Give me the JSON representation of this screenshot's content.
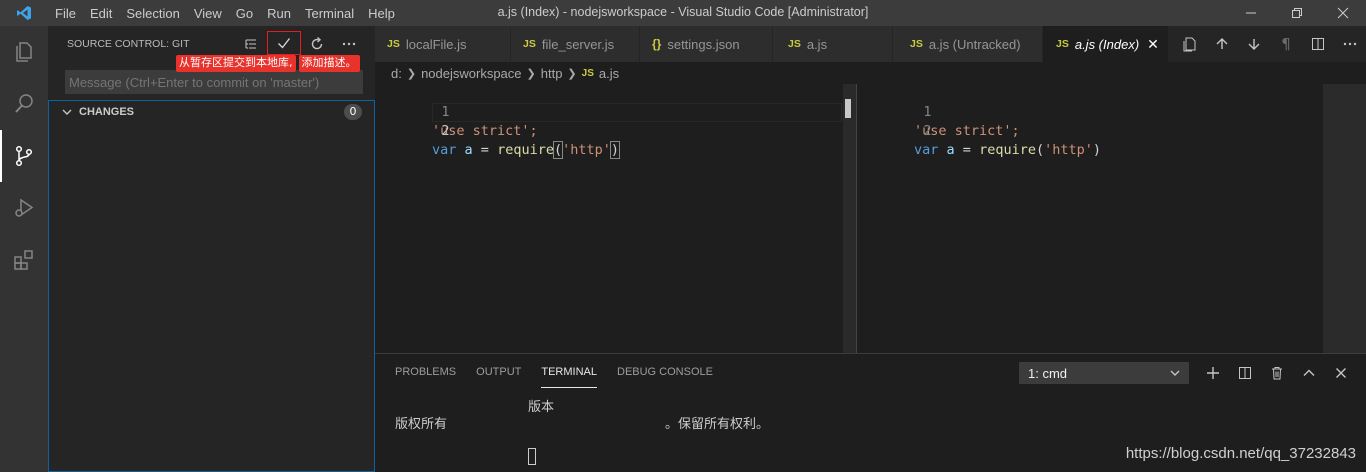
{
  "titlebar": {
    "menu": [
      "File",
      "Edit",
      "Selection",
      "View",
      "Go",
      "Run",
      "Terminal",
      "Help"
    ],
    "title": "a.js (Index) - nodejsworkspace - Visual Studio Code [Administrator]"
  },
  "activity_bar": {
    "icons": [
      "explorer-icon",
      "search-icon",
      "source-control-icon",
      "run-debug-icon",
      "extensions-icon"
    ],
    "active": "source-control-icon"
  },
  "sidebar": {
    "title": "SOURCE CONTROL: GIT",
    "actions": [
      "view-as-tree-icon",
      "commit-check-icon",
      "refresh-icon",
      "more-actions-icon"
    ],
    "annotation": [
      "从暂存区提交到本地库,",
      "添加描述。"
    ],
    "message_placeholder": "Message (Ctrl+Enter to commit on 'master')",
    "changes_label": "CHANGES",
    "changes_count": "0"
  },
  "tabs": [
    {
      "icon": "JS",
      "label": "localFile.js",
      "active": false
    },
    {
      "icon": "JS",
      "label": "file_server.js",
      "active": false
    },
    {
      "icon": "{}",
      "label": "settings.json",
      "active": false
    },
    {
      "icon": "JS",
      "label": "a.js",
      "active": false
    },
    {
      "icon": "JS",
      "label": "a.js (Untracked)",
      "active": false
    },
    {
      "icon": "JS",
      "label": "a.js (Index)",
      "active": true
    }
  ],
  "breadcrumb": {
    "parts": [
      "d:",
      "nodejsworkspace",
      "http"
    ],
    "file_icon": "JS",
    "file": "a.js"
  },
  "editor": {
    "line_numbers": [
      "1",
      "2"
    ],
    "left": {
      "line1": "'use strict';",
      "line2": {
        "kw": "var",
        "var": "a",
        "eq": " = ",
        "fn": "require",
        "open": "(",
        "str": "'http'",
        "close": ")"
      }
    },
    "right": {
      "line1": "'use strict';",
      "line2": {
        "kw": "var",
        "var": "a",
        "eq": " = ",
        "fn": "require",
        "open": "(",
        "str": "'http'",
        "close": ")"
      }
    }
  },
  "panel": {
    "tabs": [
      "PROBLEMS",
      "OUTPUT",
      "TERMINAL",
      "DEBUG CONSOLE"
    ],
    "active_tab": "TERMINAL",
    "terminal_select": "1: cmd",
    "terminal_lines": {
      "version": "版本",
      "copyright": "版权所有",
      "rights": "。保留所有权利。"
    }
  },
  "watermark": "https://blog.csdn.net/qq_37232843"
}
